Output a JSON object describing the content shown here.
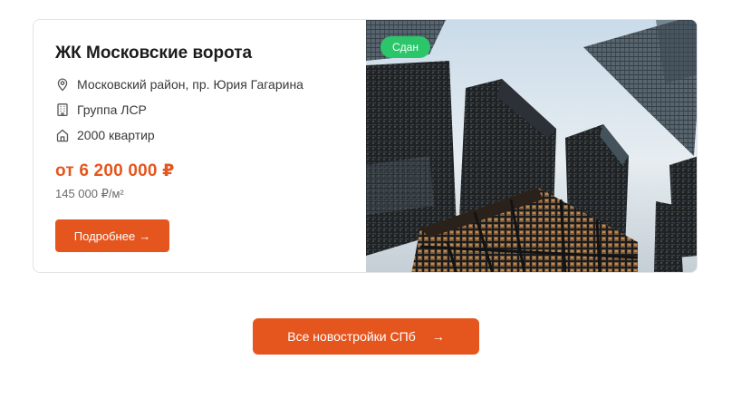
{
  "complex": {
    "title": "ЖК Московские ворота",
    "address": "Московский район, пр. Юрия Гагарина",
    "developer": "Группа ЛСР",
    "apartments": "2000 квартир",
    "price": "от 6 200 000 ₽",
    "price_per_sqm": "145 000 ₽/м²",
    "details_label": "Подробнее",
    "details_arrow": "→",
    "status_badge": "Сдан",
    "status_color": "#2cc66a"
  },
  "icons": {
    "address": "map-pin-icon",
    "developer": "building-icon",
    "apartments": "house-icon"
  },
  "footer": {
    "all_label": "Все новостройки СПб",
    "all_arrow": "→"
  },
  "colors": {
    "accent": "#e5561f",
    "text": "#1c1c1e",
    "muted": "#6c6c70"
  }
}
